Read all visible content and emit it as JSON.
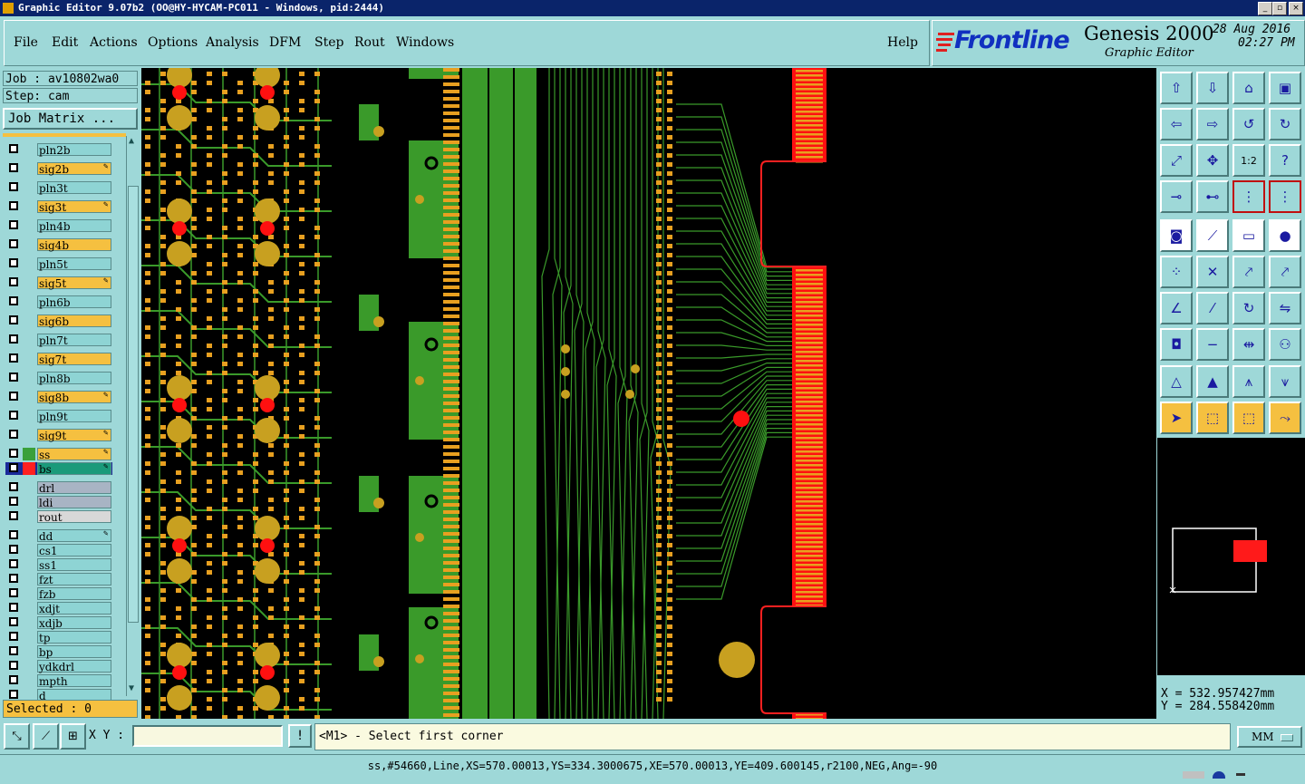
{
  "window": {
    "title": "Graphic Editor 9.07b2 (OO@HY-HYCAM-PC011 - Windows, pid:2444)",
    "minimize": "_",
    "maximize": "▫",
    "close": "×"
  },
  "menu": {
    "items": [
      "File",
      "Edit",
      "Actions",
      "Options",
      "Analysis",
      "DFM",
      "Step",
      "Rout",
      "Windows"
    ],
    "help": "Help"
  },
  "brand": {
    "logo": "Frontline",
    "product": "Genesis 2000",
    "subtitle": "Graphic Editor",
    "date": "28 Aug 2016",
    "time": "02:27 PM"
  },
  "job": {
    "job_label": "Job : av10802wa0",
    "step_label": "Step: cam",
    "matrix_button": "Job Matrix ..."
  },
  "layers": [
    {
      "name": "pln2b",
      "color": "#8ed4d4",
      "editable": false
    },
    {
      "name": "sig2b",
      "color": "#f5c040",
      "editable": true
    },
    {
      "name": "pln3t",
      "color": "#8ed4d4",
      "editable": false
    },
    {
      "name": "sig3t",
      "color": "#f5c040",
      "editable": true
    },
    {
      "name": "pln4b",
      "color": "#8ed4d4",
      "editable": false
    },
    {
      "name": "sig4b",
      "color": "#f5c040",
      "editable": false
    },
    {
      "name": "pln5t",
      "color": "#8ed4d4",
      "editable": false
    },
    {
      "name": "sig5t",
      "color": "#f5c040",
      "editable": true
    },
    {
      "name": "pln6b",
      "color": "#8ed4d4",
      "editable": false
    },
    {
      "name": "sig6b",
      "color": "#f5c040",
      "editable": false
    },
    {
      "name": "pln7t",
      "color": "#8ed4d4",
      "editable": false
    },
    {
      "name": "sig7t",
      "color": "#f5c040",
      "editable": false
    },
    {
      "name": "pln8b",
      "color": "#8ed4d4",
      "editable": false
    },
    {
      "name": "sig8b",
      "color": "#f5c040",
      "editable": true
    },
    {
      "name": "pln9t",
      "color": "#8ed4d4",
      "editable": false
    },
    {
      "name": "sig9t",
      "color": "#f5c040",
      "editable": true
    },
    {
      "name": "ss",
      "color": "#f5c040",
      "editable": true,
      "swatch": "#3aa03a"
    },
    {
      "name": "bs",
      "color": "#1a9a7a",
      "editable": true,
      "swatch": "#ff2020",
      "active": true
    },
    {
      "name": "drl",
      "color": "#a8b4c4",
      "editable": false
    },
    {
      "name": "ldi",
      "color": "#a8b4c4",
      "editable": false
    },
    {
      "name": "rout",
      "color": "#d8d8d8",
      "editable": false
    },
    {
      "name": "dd",
      "color": "#8ed4d4",
      "editable": true
    },
    {
      "name": "cs1",
      "color": "#8ed4d4",
      "editable": false
    },
    {
      "name": "ss1",
      "color": "#8ed4d4",
      "editable": false
    },
    {
      "name": "fzt",
      "color": "#8ed4d4",
      "editable": false
    },
    {
      "name": "fzb",
      "color": "#8ed4d4",
      "editable": false
    },
    {
      "name": "xdjt",
      "color": "#8ed4d4",
      "editable": false
    },
    {
      "name": "xdjb",
      "color": "#8ed4d4",
      "editable": false
    },
    {
      "name": "tp",
      "color": "#8ed4d4",
      "editable": false
    },
    {
      "name": "bp",
      "color": "#8ed4d4",
      "editable": false
    },
    {
      "name": "ydkdrl",
      "color": "#8ed4d4",
      "editable": false
    },
    {
      "name": "mpth",
      "color": "#8ed4d4",
      "editable": false
    },
    {
      "name": "d",
      "color": "#8ed4d4",
      "editable": false
    }
  ],
  "selected": "Selected : 0",
  "coords": {
    "x": "X = 532.957427mm",
    "y": "Y = 284.558420mm"
  },
  "command": {
    "xy_label": "X Y :",
    "xy_value": "",
    "alert": "!",
    "prompt": "<M1> - Select first corner",
    "units": "MM"
  },
  "status": "ss,#54660,Line,XS=570.00013,YS=334.3000675,XE=570.00013,YE=409.600145,r2100,NEG,Ang=-90",
  "colors": {
    "panel": "#9ed8d8",
    "pad_orange": "#e8a020",
    "trace_green": "#3a9a2a",
    "pad_gold": "#c8a020",
    "drill_red": "#ff1010",
    "outline_red": "#ff2020"
  }
}
